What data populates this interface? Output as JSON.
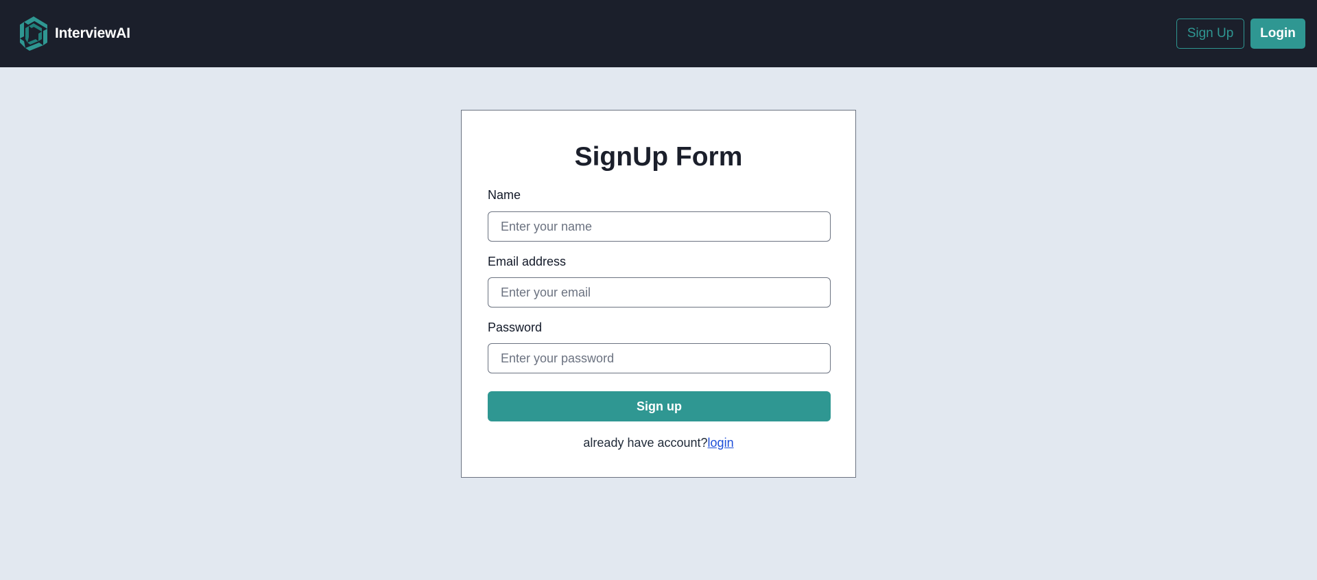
{
  "header": {
    "brand_name": "InterviewAI",
    "logo_icon": "hexagon-swirl-logo-icon",
    "signup_label": "Sign Up",
    "login_label": "Login"
  },
  "form": {
    "title": "SignUp Form",
    "name_label": "Name",
    "name_placeholder": "Enter your name",
    "name_value": "",
    "email_label": "Email address",
    "email_placeholder": "Enter your email",
    "email_value": "",
    "password_label": "Password",
    "password_placeholder": "Enter your password",
    "password_value": "",
    "submit_label": "Sign up",
    "footer_text": "already have account?",
    "footer_link": "login"
  },
  "colors": {
    "navbar_bg": "#1b1f2b",
    "accent": "#2f9792",
    "page_bg": "#e2e8f0",
    "link": "#1d4ed8"
  }
}
